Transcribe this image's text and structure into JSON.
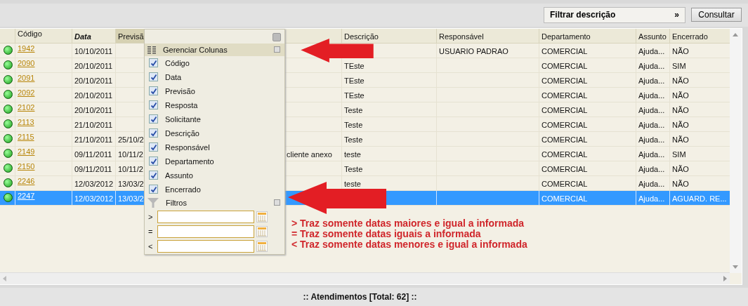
{
  "toolbar": {
    "filter_button": {
      "label": "Filtrar descrição",
      "arrow": "»"
    },
    "search_button": "Consultar"
  },
  "table": {
    "columns": [
      "",
      "Código",
      "Data",
      "Previsã",
      "",
      "Descrição",
      "Responsável",
      "Departamento",
      "Assunto",
      "Encerrado"
    ],
    "rows": [
      {
        "codigo": "1942",
        "data": "10/10/2011",
        "previsao": "",
        "column_5": "",
        "descricao": "",
        "responsavel": "USUARIO PADRAO",
        "departamento": "COMERCIAL",
        "assunto": "Ajuda...",
        "encerrado": "NÃO",
        "selected": false
      },
      {
        "codigo": "2090",
        "data": "20/10/2011",
        "previsao": "",
        "column_5": "",
        "descricao": "TEste",
        "responsavel": "",
        "departamento": "COMERCIAL",
        "assunto": "Ajuda...",
        "encerrado": "SIM",
        "selected": false
      },
      {
        "codigo": "2091",
        "data": "20/10/2011",
        "previsao": "",
        "column_5": "",
        "descricao": "TEste",
        "responsavel": "",
        "departamento": "COMERCIAL",
        "assunto": "Ajuda...",
        "encerrado": "NÃO",
        "selected": false
      },
      {
        "codigo": "2092",
        "data": "20/10/2011",
        "previsao": "",
        "column_5": "",
        "descricao": "TEste",
        "responsavel": "",
        "departamento": "COMERCIAL",
        "assunto": "Ajuda...",
        "encerrado": "NÃO",
        "selected": false
      },
      {
        "codigo": "2102",
        "data": "20/10/2011",
        "previsao": "",
        "column_5": "",
        "descricao": "Teste",
        "responsavel": "",
        "departamento": "COMERCIAL",
        "assunto": "Ajuda...",
        "encerrado": "NÃO",
        "selected": false
      },
      {
        "codigo": "2113",
        "data": "21/10/2011",
        "previsao": "",
        "column_5": "",
        "descricao": "Teste",
        "responsavel": "",
        "departamento": "COMERCIAL",
        "assunto": "Ajuda...",
        "encerrado": "NÃO",
        "selected": false
      },
      {
        "codigo": "2115",
        "data": "21/10/2011",
        "previsao": "25/10/2",
        "column_5": "",
        "descricao": "Teste",
        "responsavel": "",
        "departamento": "COMERCIAL",
        "assunto": "Ajuda...",
        "encerrado": "NÃO",
        "selected": false
      },
      {
        "codigo": "2149",
        "data": "09/11/2011",
        "previsao": "10/11/2",
        "column_5": "cliente anexo",
        "descricao": "teste",
        "responsavel": "",
        "departamento": "COMERCIAL",
        "assunto": "Ajuda...",
        "encerrado": "SIM",
        "selected": false
      },
      {
        "codigo": "2150",
        "data": "09/11/2011",
        "previsao": "10/11/2",
        "column_5": "",
        "descricao": "Teste",
        "responsavel": "",
        "departamento": "COMERCIAL",
        "assunto": "Ajuda...",
        "encerrado": "NÃO",
        "selected": false
      },
      {
        "codigo": "2246",
        "data": "12/03/2012",
        "previsao": "13/03/2",
        "column_5": "",
        "descricao": "teste",
        "responsavel": "",
        "departamento": "COMERCIAL",
        "assunto": "Ajuda...",
        "encerrado": "NÃO",
        "selected": false
      },
      {
        "codigo": "2247",
        "data": "12/03/2012",
        "previsao": "13/03/2",
        "column_5": "",
        "descricao": "",
        "responsavel": "",
        "departamento": "COMERCIAL",
        "assunto": "Ajuda...",
        "encerrado": "AGUARD. RE...",
        "selected": true
      }
    ]
  },
  "column_menu": {
    "section_columns": "Gerenciar Colunas",
    "columns": [
      {
        "label": "Código",
        "checked": true
      },
      {
        "label": "Data",
        "checked": true
      },
      {
        "label": "Previsão",
        "checked": true
      },
      {
        "label": "Resposta",
        "checked": true
      },
      {
        "label": "Solicitante",
        "checked": true
      },
      {
        "label": "Descrição",
        "checked": true
      },
      {
        "label": "Responsável",
        "checked": true
      },
      {
        "label": "Departamento",
        "checked": true
      },
      {
        "label": "Assunto",
        "checked": true
      },
      {
        "label": "Encerrado",
        "checked": true
      }
    ],
    "section_filters": "Filtros",
    "filters": [
      {
        "operator": ">"
      },
      {
        "operator": "="
      },
      {
        "operator": "<"
      }
    ]
  },
  "annotations": [
    "> Traz somente datas maiores e igual a informada",
    "= Traz somente datas iguais a informada",
    "< Traz somente datas menores e igual a informada"
  ],
  "status_bar": ":: Atendimentos [Total: 62] ::"
}
